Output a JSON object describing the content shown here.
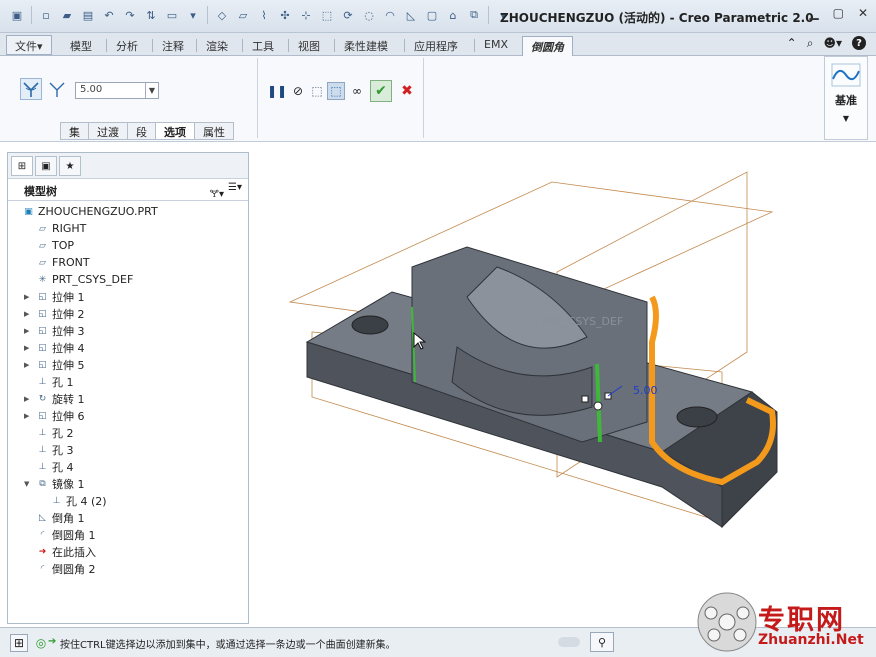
{
  "window": {
    "title": "ZHOUCHENGZUO (活动的) - Creo Parametric 2.0",
    "controls": [
      "minimize",
      "maximize",
      "close"
    ]
  },
  "ribbon_tabs": [
    {
      "label": "文件",
      "dropdown": "▾"
    },
    {
      "label": "模型"
    },
    {
      "label": "分析"
    },
    {
      "label": "注释"
    },
    {
      "label": "渲染"
    },
    {
      "label": "工具"
    },
    {
      "label": "视图"
    },
    {
      "label": "柔性建模"
    },
    {
      "label": "应用程序"
    },
    {
      "label": "EMX"
    },
    {
      "label": "倒圆角",
      "active": true
    }
  ],
  "fillet_dashboard": {
    "radius_value": "5.00",
    "subtabs": [
      "集",
      "过渡",
      "段",
      "选项",
      "属性"
    ],
    "active_subtab": "选项"
  },
  "datum": {
    "label": "基准"
  },
  "model_tree": {
    "title": "模型树",
    "nodes": [
      {
        "label": "ZHOUCHENGZUO.PRT",
        "icon": "part-icon"
      },
      {
        "label": "RIGHT",
        "icon": "datum-plane-icon"
      },
      {
        "label": "TOP",
        "icon": "datum-plane-icon"
      },
      {
        "label": "FRONT",
        "icon": "datum-plane-icon"
      },
      {
        "label": "PRT_CSYS_DEF",
        "icon": "csys-icon"
      },
      {
        "label": "拉伸 1",
        "icon": "extrude-icon",
        "expandable": true
      },
      {
        "label": "拉伸 2",
        "icon": "extrude-icon",
        "expandable": true
      },
      {
        "label": "拉伸 3",
        "icon": "extrude-icon",
        "expandable": true
      },
      {
        "label": "拉伸 4",
        "icon": "extrude-icon",
        "expandable": true
      },
      {
        "label": "拉伸 5",
        "icon": "extrude-icon",
        "expandable": true
      },
      {
        "label": "孔 1",
        "icon": "hole-icon"
      },
      {
        "label": "旋转 1",
        "icon": "revolve-icon",
        "expandable": true
      },
      {
        "label": "拉伸 6",
        "icon": "extrude-icon",
        "expandable": true
      },
      {
        "label": "孔 2",
        "icon": "hole-icon"
      },
      {
        "label": "孔 3",
        "icon": "hole-icon"
      },
      {
        "label": "孔 4",
        "icon": "hole-icon"
      },
      {
        "label": "镜像 1",
        "icon": "mirror-icon",
        "expanded": true
      },
      {
        "label": "孔 4 (2)",
        "icon": "hole-icon",
        "indent": true
      },
      {
        "label": "倒角 1",
        "icon": "chamfer-icon"
      },
      {
        "label": "倒圆角 1",
        "icon": "round-icon"
      },
      {
        "label": "在此插入",
        "icon": "insert-here-icon"
      },
      {
        "label": "倒圆角 2",
        "icon": "round-icon"
      }
    ]
  },
  "viewport": {
    "csys_label": "PRT_CSYS_DEF",
    "dimension_label": "5.00"
  },
  "status": {
    "message": "按住CTRL键选择边以添加到集中，或通过选择一条边或一个曲面创建新集。"
  },
  "watermark": {
    "cn": "专职网",
    "en": "Zhuanzhi.Net"
  },
  "colors": {
    "highlight_orange": "#f39a1c",
    "selected_green": "#3fb83a",
    "model_gray": "#5a5f68",
    "accept_green": "#2e9b2e",
    "cancel_red": "#d12020"
  }
}
